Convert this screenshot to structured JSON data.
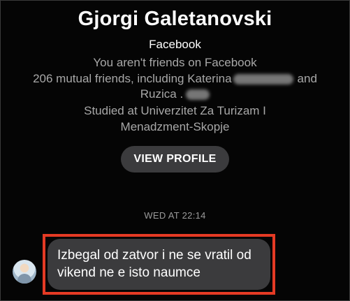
{
  "profile": {
    "name": "Gjorgi Galetanovski",
    "platform": "Facebook",
    "friend_status": "You aren't friends on Facebook",
    "mutual_prefix": "206 mutual friends, including Katerina",
    "mutual_and": "and",
    "mutual_second": "Ruzica",
    "mutual_dot": ".",
    "studied_line1": "Studied at Univerzitet Za Turizam I",
    "studied_line2": "Menadzment-Skopje",
    "view_profile_label": "VIEW PROFILE"
  },
  "conversation": {
    "timestamp": "WED AT 22:14",
    "messages": [
      {
        "text": "Izbegal od zatvor i ne se vratil od vikend ne e isto naumce",
        "highlight_color": "#e53a24"
      }
    ]
  },
  "colors": {
    "background": "#050505",
    "bubble": "#3b3b3d",
    "secondary_text": "#a8a8a8",
    "highlight": "#e53a24"
  }
}
